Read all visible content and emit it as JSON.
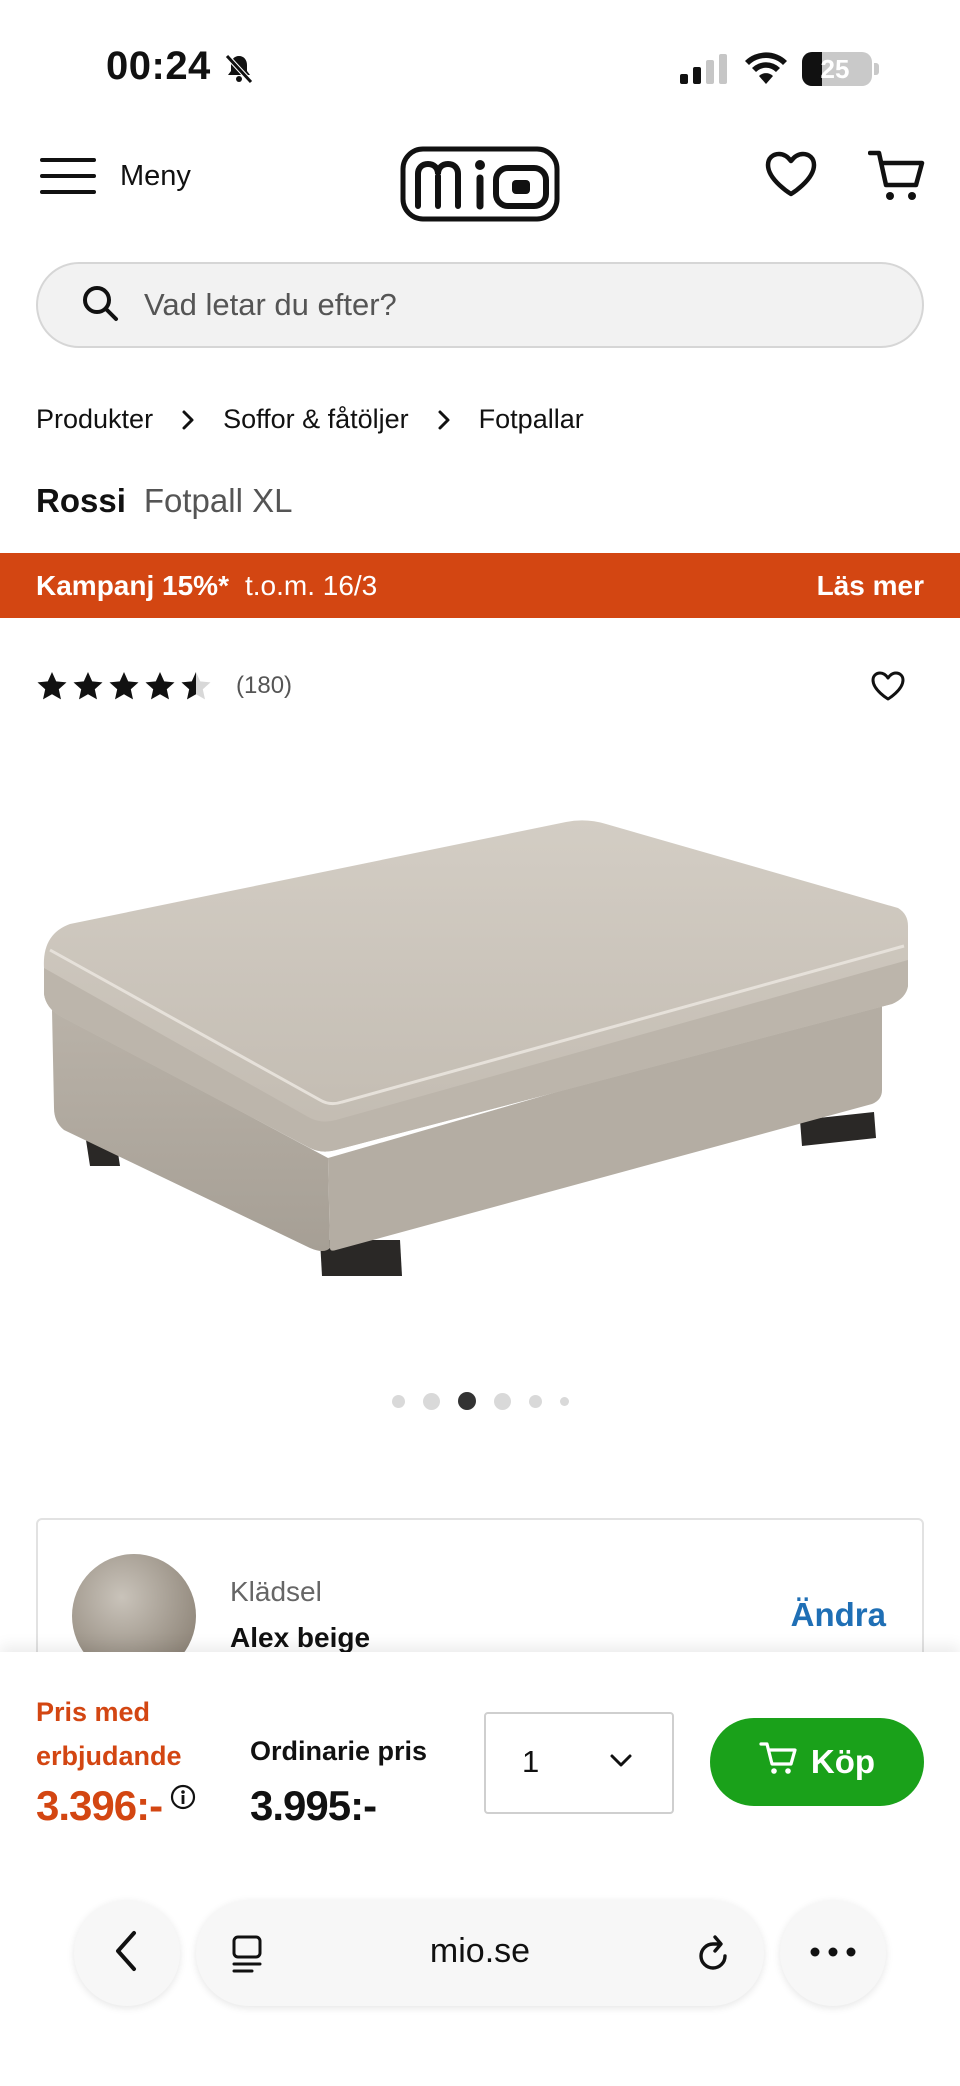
{
  "status_bar": {
    "time": "00:24",
    "battery": "25"
  },
  "header": {
    "menu_label": "Meny",
    "logo_text": "mio"
  },
  "search": {
    "placeholder": "Vad letar du efter?"
  },
  "breadcrumb": [
    "Produkter",
    "Soffor & fåtöljer",
    "Fotpallar"
  ],
  "product": {
    "brand": "Rossi",
    "model": "Fotpall XL",
    "rating": 4.5,
    "review_count": "(180)",
    "image_count": 6,
    "active_image": 3
  },
  "promo": {
    "main": "Kampanj 15%*",
    "date": "t.o.m. 16/3",
    "more": "Läs mer"
  },
  "variant": {
    "label": "Klädsel",
    "value": "Alex beige",
    "change": "Ändra"
  },
  "purchase": {
    "offer_label": "Pris med erbjudande",
    "offer_price": "3.396:-",
    "regular_label": "Ordinarie pris",
    "regular_price": "3.995:-",
    "quantity": "1",
    "buy_label": "Köp"
  },
  "browser": {
    "url": "mio.se"
  },
  "colors": {
    "promo": "#d34612",
    "buy": "#1aa11a",
    "link": "#1f6fb5"
  }
}
